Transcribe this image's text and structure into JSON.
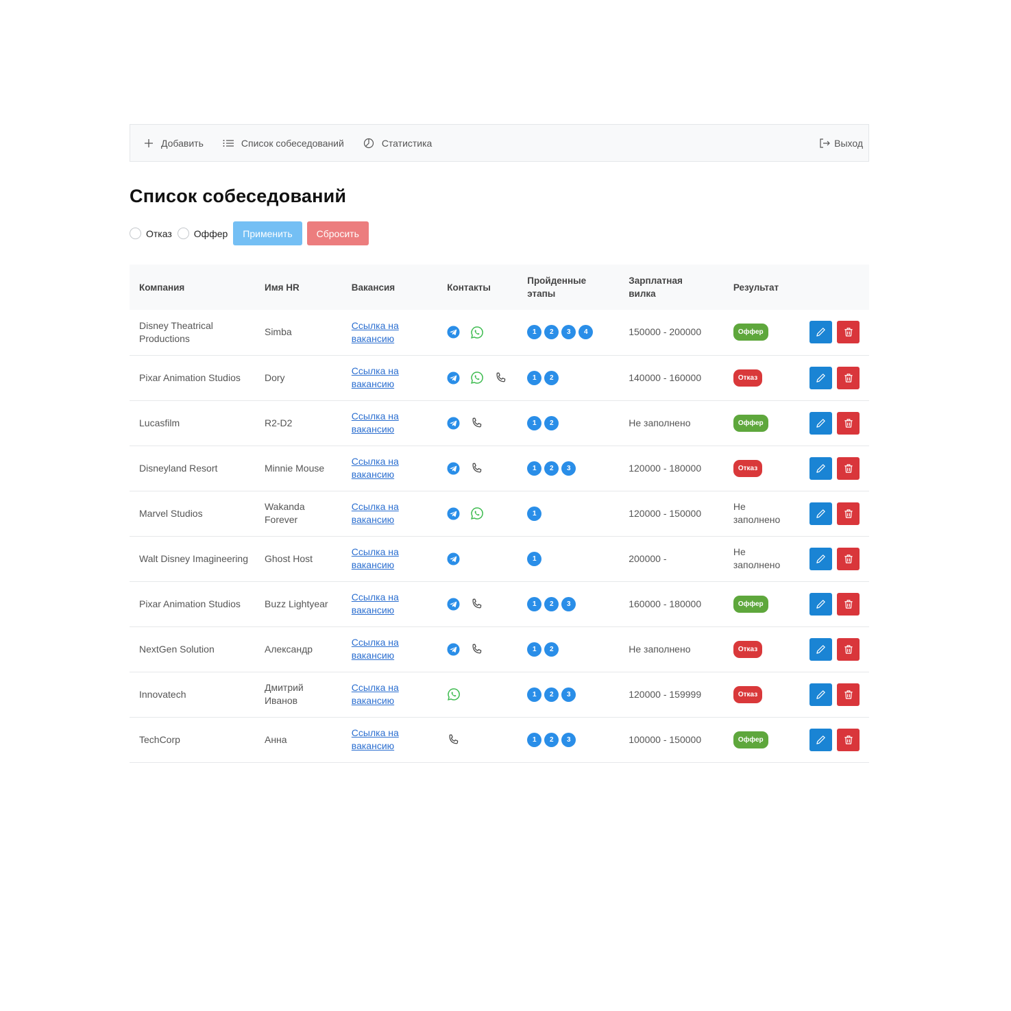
{
  "navbar": {
    "add_label": "Добавить",
    "list_label": "Список собеседований",
    "stats_label": "Статистика",
    "logout_label": "Выход"
  },
  "page": {
    "title": "Список собеседований"
  },
  "filters": {
    "reject_label": "Отказ",
    "offer_label": "Оффер",
    "apply_label": "Применить",
    "reset_label": "Сбросить"
  },
  "table": {
    "headers": {
      "company": "Компания",
      "hr": "Имя HR",
      "vacancy": "Вакансия",
      "contacts": "Контакты",
      "stages": "Пройденные этапы",
      "salary": "Зарплатная вилка",
      "result": "Результат"
    },
    "rows": [
      {
        "company": "Disney Theatrical Productions",
        "hr": "Simba",
        "link": "Ссылка на вакансию",
        "contacts": [
          "telegram",
          "whatsapp"
        ],
        "stages": [
          "1",
          "2",
          "3",
          "4"
        ],
        "salary": "150000 - 200000",
        "result": "Оффер",
        "result_type": "offer"
      },
      {
        "company": "Pixar Animation Studios",
        "hr": "Dory",
        "link": "Ссылка на вакансию",
        "contacts": [
          "telegram",
          "whatsapp",
          "phone"
        ],
        "stages": [
          "1",
          "2"
        ],
        "salary": "140000 - 160000",
        "result": "Отказ",
        "result_type": "reject"
      },
      {
        "company": "Lucasfilm",
        "hr": "R2-D2",
        "link": "Ссылка на вакансию",
        "contacts": [
          "telegram",
          "phone"
        ],
        "stages": [
          "1",
          "2"
        ],
        "salary": "Не заполнено",
        "result": "Оффер",
        "result_type": "offer"
      },
      {
        "company": "Disneyland Resort",
        "hr": "Minnie Mouse",
        "link": "Ссылка на вакансию",
        "contacts": [
          "telegram",
          "phone"
        ],
        "stages": [
          "1",
          "2",
          "3"
        ],
        "salary": "120000 - 180000",
        "result": "Отказ",
        "result_type": "reject"
      },
      {
        "company": "Marvel Studios",
        "hr": "Wakanda Forever",
        "link": "Ссылка на вакансию",
        "contacts": [
          "telegram",
          "whatsapp"
        ],
        "stages": [
          "1"
        ],
        "salary": "120000 - 150000",
        "result": "Не заполнено",
        "result_type": "none"
      },
      {
        "company": "Walt Disney Imagineering",
        "hr": "Ghost Host",
        "link": "Ссылка на вакансию",
        "contacts": [
          "telegram"
        ],
        "stages": [
          "1"
        ],
        "salary": "200000 -",
        "result": "Не заполнено",
        "result_type": "none"
      },
      {
        "company": "Pixar Animation Studios",
        "hr": "Buzz Lightyear",
        "link": "Ссылка на вакансию",
        "contacts": [
          "telegram",
          "phone"
        ],
        "stages": [
          "1",
          "2",
          "3"
        ],
        "salary": "160000 - 180000",
        "result": "Оффер",
        "result_type": "offer"
      },
      {
        "company": "NextGen Solution",
        "hr": "Александр",
        "link": "Ссылка на вакансию",
        "contacts": [
          "telegram",
          "phone"
        ],
        "stages": [
          "1",
          "2"
        ],
        "salary": "Не заполнено",
        "result": "Отказ",
        "result_type": "reject"
      },
      {
        "company": "Innovatech",
        "hr": "Дмитрий Иванов",
        "link": "Ссылка на вакансию",
        "contacts": [
          "whatsapp"
        ],
        "stages": [
          "1",
          "2",
          "3"
        ],
        "salary": "120000 - 159999",
        "result": "Отказ",
        "result_type": "reject"
      },
      {
        "company": "TechCorp",
        "hr": "Анна",
        "link": "Ссылка на вакансию",
        "contacts": [
          "phone"
        ],
        "stages": [
          "1",
          "2",
          "3"
        ],
        "salary": "100000 - 150000",
        "result": "Оффер",
        "result_type": "offer"
      }
    ]
  },
  "colors": {
    "telegram": "#2a8ee8",
    "whatsapp": "#3dbb4f",
    "phone": "#444444",
    "stage": "#2a8ee8",
    "offer": "#5ea73c",
    "reject": "#d9383a",
    "edit": "#1a84d4",
    "delete": "#d9363b"
  }
}
